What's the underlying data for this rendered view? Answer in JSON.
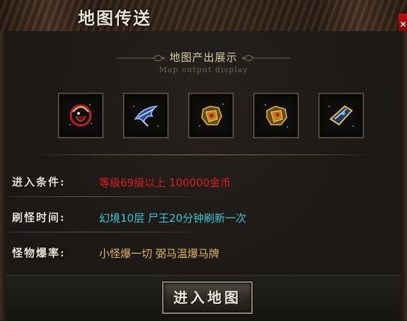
{
  "window": {
    "title": "地图传送",
    "close_label": "×"
  },
  "output_section": {
    "title": "地图产出展示",
    "subtitle_en": "Map output display",
    "items": [
      {
        "icon": "red-helmet-icon"
      },
      {
        "icon": "blue-feather-icon"
      },
      {
        "icon": "gold-armor-icon"
      },
      {
        "icon": "gold-armor-icon"
      },
      {
        "icon": "gold-bracer-icon"
      }
    ]
  },
  "info": {
    "rows": [
      {
        "label": "进入条件:",
        "value": "等级69级以上 100000金币",
        "color": "#e01c1c"
      },
      {
        "label": "刷怪时间:",
        "value": "幻境10层  尸王20分钟刷新一次",
        "color": "#3ec6d6"
      },
      {
        "label": "怪物爆率:",
        "value": "小怪爆一切 弼马温爆马牌",
        "color": "#e0b45a"
      }
    ]
  },
  "actions": {
    "enter_label": "进入地图"
  }
}
